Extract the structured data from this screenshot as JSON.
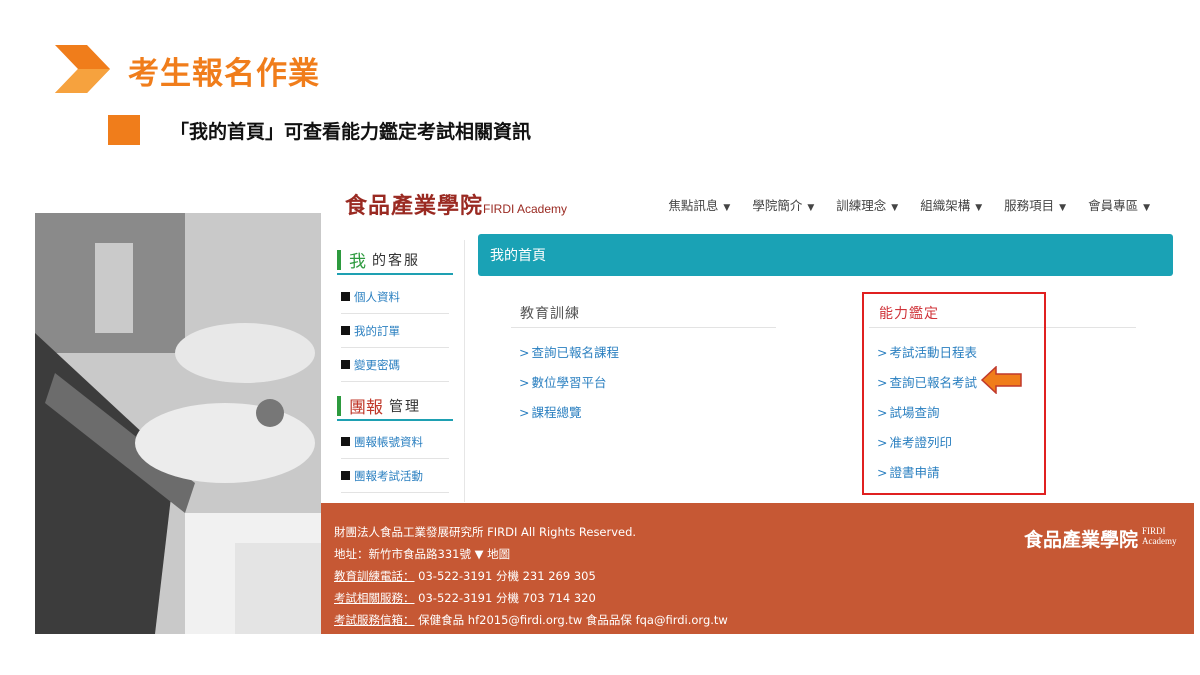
{
  "slide": {
    "title": "考生報名作業",
    "subtitle": "「我的首頁」可查看能力鑑定考試相關資訊"
  },
  "site": {
    "logo_cn": "食品產業學院",
    "logo_en": "FIRDI Academy",
    "nav": [
      "焦點訊息",
      "學院簡介",
      "訓練理念",
      "組織架構",
      "服務項目",
      "會員專區"
    ],
    "sidebar": {
      "service_head_big": "我",
      "service_head_small": "的客服",
      "service_items": [
        "個人資料",
        "我的訂單",
        "變更密碼"
      ],
      "group_head_big": "團報",
      "group_head_small": "管理",
      "group_items": [
        "團報帳號資料",
        "團報考試活動"
      ]
    },
    "content_title": "我的首頁",
    "training": {
      "title": "教育訓練",
      "links": [
        "查詢已報名課程",
        "數位學習平台",
        "課程總覽"
      ]
    },
    "certification": {
      "title": "能力鑑定",
      "links": [
        "考試活動日程表",
        "查詢已報名考試",
        "試場查詢",
        "准考證列印",
        "證書申請"
      ]
    },
    "footer": {
      "line1": "財團法人食品工業發展研究所 FIRDI All Rights Reserved.",
      "address_label": "地址：新竹市食品路331號",
      "map_label": "地圖",
      "training_phone_label": "教育訓練電話：",
      "training_phone": "03-522-3191 分機 231 269 305",
      "exam_service_label": "考試相關服務：",
      "exam_service": "03-522-3191 分機 703 714 320",
      "exam_mail_label": "考試服務信箱：",
      "exam_mail": "保健食品 hf2015@firdi.org.tw 食品品保 fqa@firdi.org.tw",
      "logo_cn": "食品產業學院",
      "logo_en_1": "FIRDI",
      "logo_en_2": "Academy"
    }
  },
  "colors": {
    "accent_orange": "#f07d1b",
    "teal": "#1aa2b5",
    "footer": "#c65834",
    "highlight_red": "#e02020",
    "link_blue": "#2a7fc0"
  }
}
